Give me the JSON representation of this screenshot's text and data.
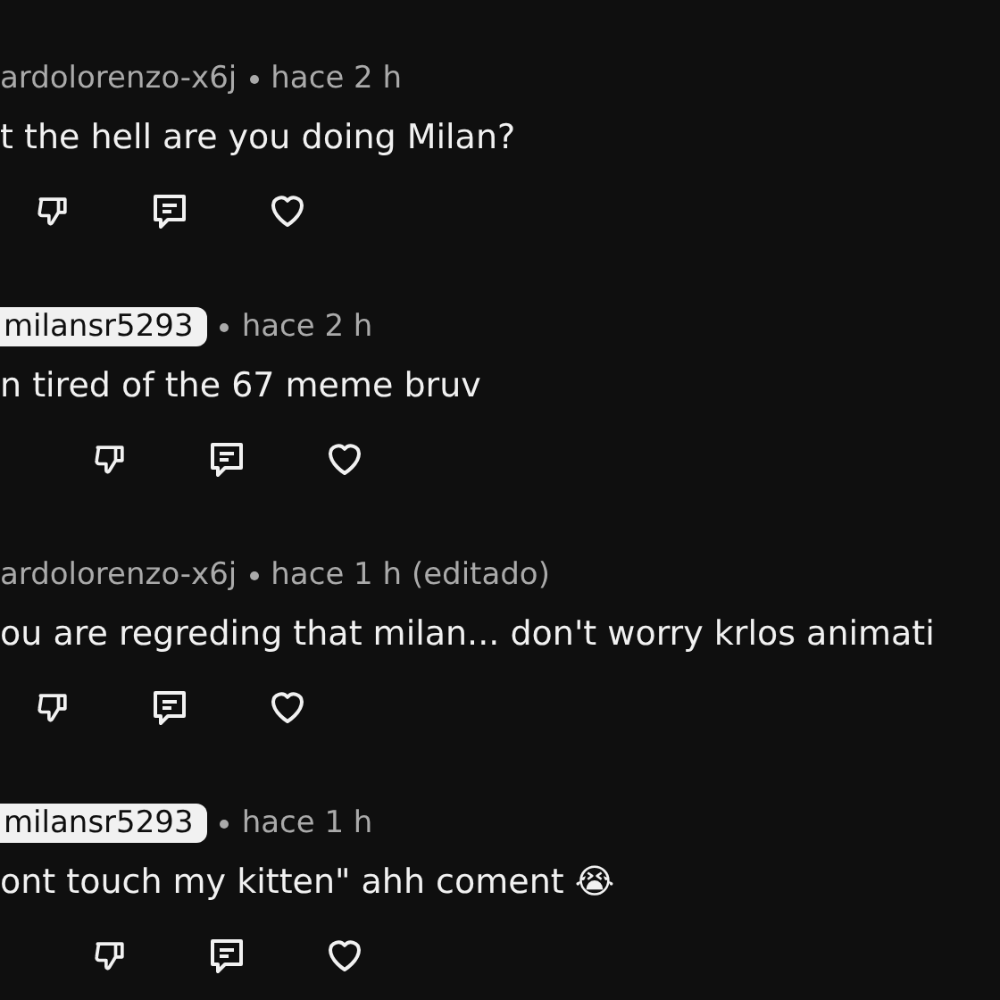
{
  "comments": [
    {
      "kind": "comment",
      "author": "ardolorenzo-x6j",
      "author_highlighted": false,
      "time": "hace 2 h",
      "text": "t the hell are you doing Milan?"
    },
    {
      "kind": "reply",
      "author": "milansr5293",
      "author_highlighted": true,
      "time": "hace 2 h",
      "text": "n tired of the 67 meme bruv"
    },
    {
      "kind": "comment",
      "author": "ardolorenzo-x6j",
      "author_highlighted": false,
      "time": "hace 1 h (editado)",
      "text": "ou are regreding that milan... don't worry krlos animati"
    },
    {
      "kind": "reply",
      "author": "milansr5293",
      "author_highlighted": true,
      "time": "hace 1 h",
      "text": "ont touch my kitten\" ahh coment 😭"
    }
  ]
}
